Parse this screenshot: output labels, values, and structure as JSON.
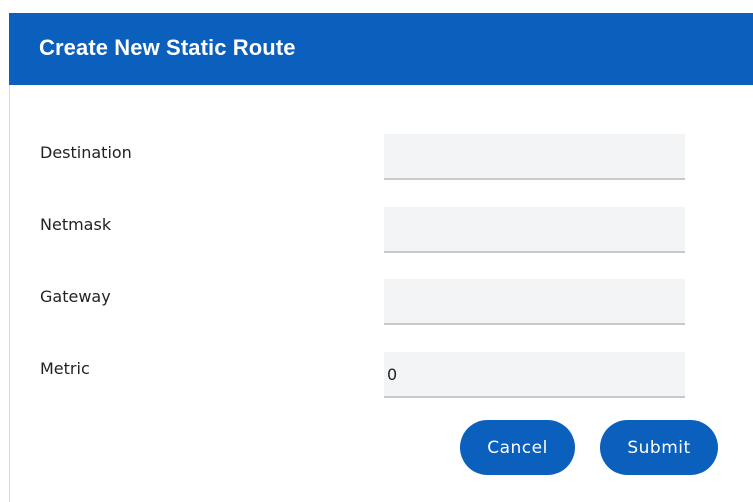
{
  "dialog": {
    "title": "Create New Static Route"
  },
  "form": {
    "fields": [
      {
        "label": "Destination",
        "value": "",
        "placeholder": ""
      },
      {
        "label": "Netmask",
        "value": "",
        "placeholder": ""
      },
      {
        "label": "Gateway",
        "value": "",
        "placeholder": ""
      },
      {
        "label": "Metric",
        "value": "0",
        "placeholder": ""
      }
    ]
  },
  "actions": {
    "cancel_label": "Cancel",
    "submit_label": "Submit"
  },
  "colors": {
    "primary": "#0b5fbd",
    "input_background": "#f3f4f6",
    "input_underline": "#c7c9cc"
  }
}
